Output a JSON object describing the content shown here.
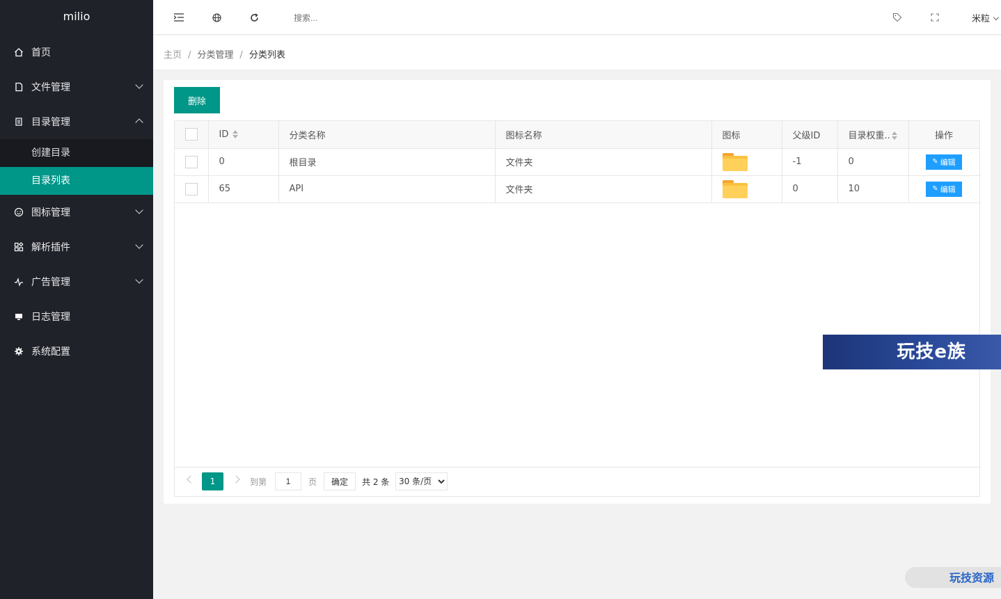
{
  "sidebar": {
    "logo": "milio",
    "items": [
      {
        "label": "首页",
        "icon": "home-icon"
      },
      {
        "label": "文件管理",
        "icon": "file-icon"
      },
      {
        "label": "目录管理",
        "icon": "directory-icon"
      },
      {
        "label": "图标管理",
        "icon": "smile-icon"
      },
      {
        "label": "解析插件",
        "icon": "apps-icon"
      },
      {
        "label": "广告管理",
        "icon": "pulse-icon"
      },
      {
        "label": "日志管理",
        "icon": "monitor-icon"
      },
      {
        "label": "系统配置",
        "icon": "gear-icon"
      }
    ],
    "sub_items": [
      {
        "label": "创建目录"
      },
      {
        "label": "目录列表"
      }
    ]
  },
  "header": {
    "search_placeholder": "搜索...",
    "user_name": "米粒"
  },
  "breadcrumb": {
    "home": "主页",
    "parent": "分类管理",
    "current": "分类列表"
  },
  "toolbar": {
    "delete_label": "删除"
  },
  "table": {
    "columns": [
      "ID",
      "分类名称",
      "图标名称",
      "图标",
      "父级ID",
      "目录权重..",
      "操作"
    ],
    "rows": [
      {
        "id": "0",
        "name": "根目录",
        "icon_name": "文件夹",
        "parent_id": "-1",
        "weight": "0",
        "action": "编辑"
      },
      {
        "id": "65",
        "name": "API",
        "icon_name": "文件夹",
        "parent_id": "0",
        "weight": "10",
        "action": "编辑"
      }
    ]
  },
  "pager": {
    "current_page": "1",
    "goto_label": "到第",
    "goto_value": "1",
    "page_unit": "页",
    "confirm_label": "确定",
    "total_label": "共 2 条",
    "page_size": "30 条/页"
  },
  "watermarks": {
    "banner": "玩技e族",
    "corner": "玩技资源"
  },
  "colors": {
    "sidebar_bg": "#20222a",
    "accent": "#009688",
    "edit_button": "#1e9fff"
  }
}
